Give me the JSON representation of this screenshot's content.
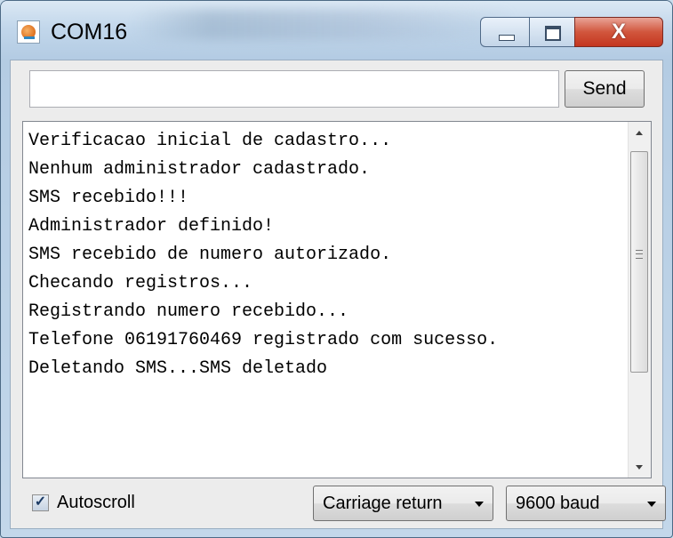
{
  "window": {
    "title": "COM16",
    "close_glyph": "X"
  },
  "input": {
    "value": "",
    "placeholder": ""
  },
  "send_label": "Send",
  "serial_lines": [
    "Verificacao inicial de cadastro...",
    "Nenhum administrador cadastrado.",
    "SMS recebido!!!",
    "Administrador definido!",
    "SMS recebido de numero autorizado.",
    "Checando registros...",
    "Registrando numero recebido...",
    "Telefone 06191760469 registrado com sucesso.",
    "Deletando SMS...SMS deletado"
  ],
  "autoscroll": {
    "label": "Autoscroll",
    "checked": true
  },
  "line_ending": {
    "selected": "Carriage return"
  },
  "baud_rate": {
    "selected": "9600 baud"
  },
  "icons": [
    "java-app-icon",
    "minimize-icon",
    "maximize-icon",
    "close-icon",
    "scroll-up-arrow-icon",
    "scroll-down-arrow-icon",
    "checkmark-icon",
    "chevron-down-icon"
  ],
  "colors": {
    "close_button": "#c4361f",
    "title_bar": "#c2d7eb",
    "client_background": "#ececec"
  }
}
